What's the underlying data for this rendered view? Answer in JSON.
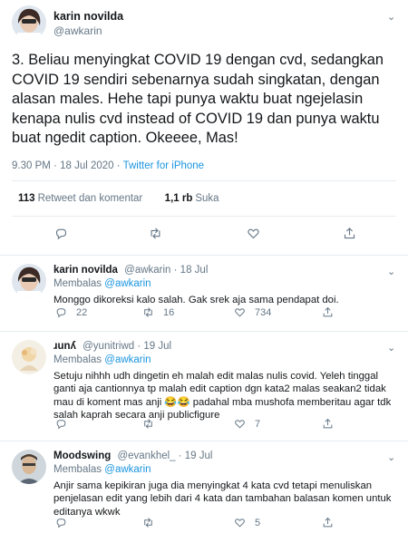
{
  "main_tweet": {
    "author_name": "karin novilda",
    "handle": "@awkarin",
    "text": "3. Beliau menyingkat COVID 19 dengan cvd, sedangkan COVID 19 sendiri sebenarnya sudah singkatan, dengan alasan males. Hehe tapi punya waktu buat ngejelasin kenapa nulis cvd instead of COVID 19 dan punya waktu buat ngedit caption. Okeeee, Mas!",
    "time": "9.30 PM",
    "date": "18 Jul 2020",
    "separator": "·",
    "source": "Twitter for iPhone",
    "retweets_count": "113",
    "retweets_label": "Retweet dan komentar",
    "likes_count": "1,1 rb",
    "likes_label": "Suka",
    "caret": "⌄"
  },
  "replies": [
    {
      "name": "karin novilda",
      "handle": "@awkarin",
      "date": "· 18 Jul",
      "replying_label": "Membalas",
      "replying_to": "@awkarin",
      "text": "Monggo dikoreksi kalo salah. Gak srek aja sama pendapat doi.",
      "reply_count": "22",
      "retweet_count": "16",
      "like_count": "734",
      "caret": "⌄"
    },
    {
      "name": "ɹunʎ",
      "handle": "@yunitriwd",
      "date": "· 19 Jul",
      "replying_label": "Membalas",
      "replying_to": "@awkarin",
      "text": "Setuju nihhh udh dingetin eh malah edit malas nulis covid. Yeleh tinggal ganti aja cantionnya tp malah edit caption dgn kata2 malas seakan2 tidak mau di koment mas anji 😂😂 padahal mba mushofa memberitau agar tdk salah kaprah secara anji publicfigure",
      "reply_count": "",
      "retweet_count": "",
      "like_count": "7",
      "caret": "⌄"
    },
    {
      "name": "Moodswing",
      "handle": "@evankhel_",
      "date": "· 19 Jul",
      "replying_label": "Membalas",
      "replying_to": "@awkarin",
      "text": "Anjir sama kepikiran juga dia menyingkat 4 kata cvd tetapi menuliskan penjelasan edit yang lebih dari 4 kata dan tambahan balasan komen untuk editanya wkwk",
      "reply_count": "",
      "retweet_count": "",
      "like_count": "5",
      "caret": "⌄"
    }
  ],
  "icons": {
    "reply": "reply-icon",
    "retweet": "retweet-icon",
    "like": "heart-icon",
    "share": "share-icon"
  },
  "colors": {
    "link": "#1b95e0",
    "secondary_text": "#657786",
    "border": "#e6ecf0"
  }
}
